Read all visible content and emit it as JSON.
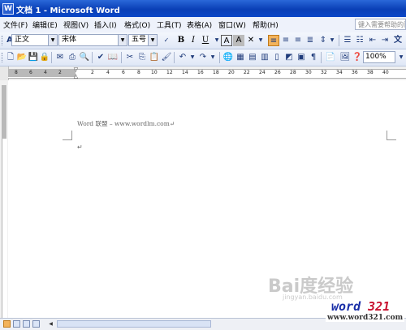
{
  "window": {
    "title": "文档 1 - Microsoft Word",
    "app_icon": "W"
  },
  "menubar": {
    "items": [
      {
        "label": "文件(F)"
      },
      {
        "label": "编辑(E)"
      },
      {
        "label": "视图(V)"
      },
      {
        "label": "插入(I)"
      },
      {
        "label": "格式(O)"
      },
      {
        "label": "工具(T)"
      },
      {
        "label": "表格(A)"
      },
      {
        "label": "窗口(W)"
      },
      {
        "label": "帮助(H)"
      }
    ],
    "help_search_placeholder": "键入需要帮助的问题"
  },
  "formatting_toolbar": {
    "style_icon": "A",
    "style_value": "正文",
    "font_value": "宋体",
    "size_value": "五号",
    "bold": "B",
    "italic": "I",
    "underline": "U",
    "font_color": "A",
    "border": "A",
    "char_shading": "A"
  },
  "standard_toolbar": {
    "zoom_value": "100%"
  },
  "ruler": {
    "ticks": [
      "8",
      "6",
      "4",
      "2",
      "2",
      "4",
      "6",
      "8",
      "10",
      "12",
      "14",
      "16",
      "18",
      "20",
      "22",
      "24",
      "26",
      "28",
      "30",
      "32",
      "34",
      "36",
      "38",
      "40"
    ]
  },
  "document": {
    "header_text": "Word 联盟 – www.wordlm.com",
    "paragraph_mark": "↵",
    "line_mark": "↵"
  },
  "watermarks": {
    "baidu_logo_text": "Bai度经验",
    "baidu_url": "jingyan.baidu.com",
    "brand_word": "word",
    "brand_num": "321",
    "brand_url": "www.word321.com"
  },
  "colors": {
    "title_bar": "#0a3fb6",
    "active_button": "#f3b35b",
    "brand_blue": "#1a2fa8",
    "brand_red": "#c8102e"
  }
}
